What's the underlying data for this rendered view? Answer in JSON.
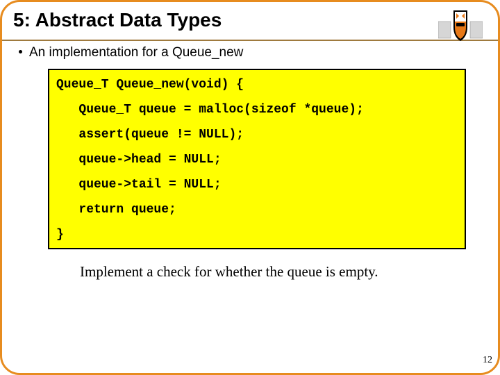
{
  "title": "5: Abstract Data Types",
  "bullet": "An implementation for a Queue_new",
  "code": {
    "l1": "Queue_T Queue_new(void) {",
    "l2": "   Queue_T queue = malloc(sizeof *queue);",
    "l3": "   assert(queue != NULL);",
    "l4": "   queue->head = NULL;",
    "l5": "   queue->tail = NULL;",
    "l6": "   return queue;",
    "l7": "}"
  },
  "note": "Implement a check for whether the queue is empty.",
  "page": "12"
}
